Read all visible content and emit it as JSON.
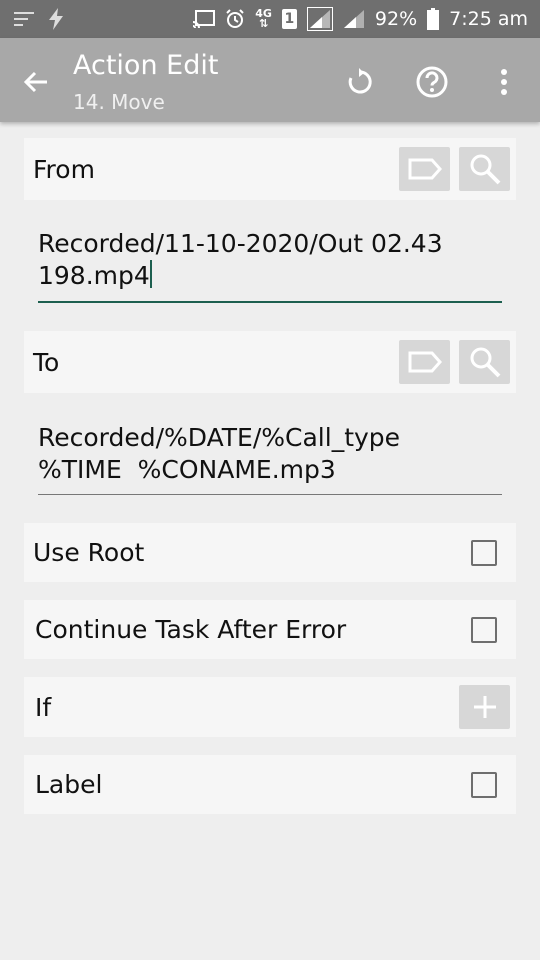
{
  "status_bar": {
    "network": "4G",
    "sim": "1",
    "battery": "92%",
    "time": "7:25 am",
    "icons": [
      "notification-icon",
      "flash-icon",
      "cast-icon",
      "alarm-icon",
      "network-4g-icon",
      "sim-icon",
      "signal-icon",
      "signal-icon",
      "battery-icon"
    ]
  },
  "toolbar": {
    "title": "Action Edit",
    "subtitle": "14. Move",
    "icons": [
      "back-arrow-icon",
      "reset-icon",
      "help-icon",
      "more-vert-icon"
    ],
    "color": "#a8a8a8"
  },
  "form": {
    "from": {
      "label": "From",
      "value": "Recorded/11-10-2020/Out 02.43\n198.mp4",
      "underline_color": "#1d5f4f"
    },
    "to": {
      "label": "To",
      "value": "Recorded/%DATE/%Call_type\n%TIME  %CONAME.mp3"
    },
    "use_root": {
      "label": "Use Root",
      "checked": false
    },
    "continue_task": {
      "label": "Continue Task After Error",
      "checked": false
    },
    "if": {
      "label": "If"
    },
    "label": {
      "label": "Label",
      "checked": false
    }
  }
}
